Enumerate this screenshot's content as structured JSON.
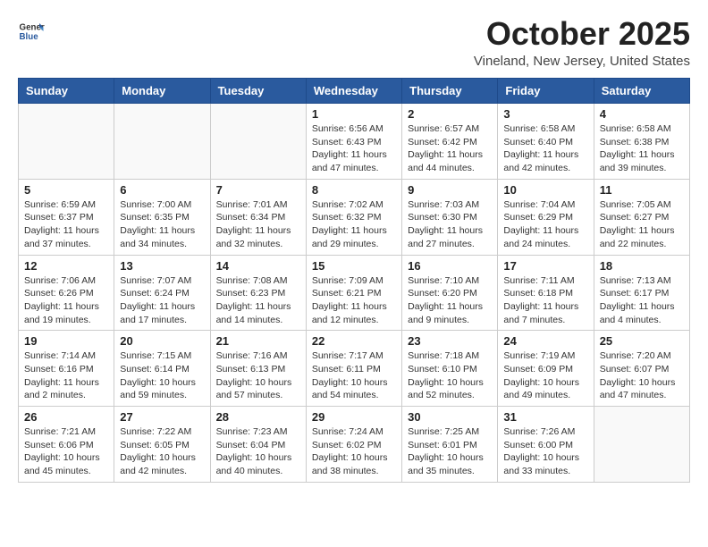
{
  "header": {
    "logo": {
      "line1": "General",
      "line2": "Blue"
    },
    "title": "October 2025",
    "location": "Vineland, New Jersey, United States"
  },
  "weekdays": [
    "Sunday",
    "Monday",
    "Tuesday",
    "Wednesday",
    "Thursday",
    "Friday",
    "Saturday"
  ],
  "weeks": [
    [
      {
        "day": "",
        "info": ""
      },
      {
        "day": "",
        "info": ""
      },
      {
        "day": "",
        "info": ""
      },
      {
        "day": "1",
        "info": "Sunrise: 6:56 AM\nSunset: 6:43 PM\nDaylight: 11 hours\nand 47 minutes."
      },
      {
        "day": "2",
        "info": "Sunrise: 6:57 AM\nSunset: 6:42 PM\nDaylight: 11 hours\nand 44 minutes."
      },
      {
        "day": "3",
        "info": "Sunrise: 6:58 AM\nSunset: 6:40 PM\nDaylight: 11 hours\nand 42 minutes."
      },
      {
        "day": "4",
        "info": "Sunrise: 6:58 AM\nSunset: 6:38 PM\nDaylight: 11 hours\nand 39 minutes."
      }
    ],
    [
      {
        "day": "5",
        "info": "Sunrise: 6:59 AM\nSunset: 6:37 PM\nDaylight: 11 hours\nand 37 minutes."
      },
      {
        "day": "6",
        "info": "Sunrise: 7:00 AM\nSunset: 6:35 PM\nDaylight: 11 hours\nand 34 minutes."
      },
      {
        "day": "7",
        "info": "Sunrise: 7:01 AM\nSunset: 6:34 PM\nDaylight: 11 hours\nand 32 minutes."
      },
      {
        "day": "8",
        "info": "Sunrise: 7:02 AM\nSunset: 6:32 PM\nDaylight: 11 hours\nand 29 minutes."
      },
      {
        "day": "9",
        "info": "Sunrise: 7:03 AM\nSunset: 6:30 PM\nDaylight: 11 hours\nand 27 minutes."
      },
      {
        "day": "10",
        "info": "Sunrise: 7:04 AM\nSunset: 6:29 PM\nDaylight: 11 hours\nand 24 minutes."
      },
      {
        "day": "11",
        "info": "Sunrise: 7:05 AM\nSunset: 6:27 PM\nDaylight: 11 hours\nand 22 minutes."
      }
    ],
    [
      {
        "day": "12",
        "info": "Sunrise: 7:06 AM\nSunset: 6:26 PM\nDaylight: 11 hours\nand 19 minutes."
      },
      {
        "day": "13",
        "info": "Sunrise: 7:07 AM\nSunset: 6:24 PM\nDaylight: 11 hours\nand 17 minutes."
      },
      {
        "day": "14",
        "info": "Sunrise: 7:08 AM\nSunset: 6:23 PM\nDaylight: 11 hours\nand 14 minutes."
      },
      {
        "day": "15",
        "info": "Sunrise: 7:09 AM\nSunset: 6:21 PM\nDaylight: 11 hours\nand 12 minutes."
      },
      {
        "day": "16",
        "info": "Sunrise: 7:10 AM\nSunset: 6:20 PM\nDaylight: 11 hours\nand 9 minutes."
      },
      {
        "day": "17",
        "info": "Sunrise: 7:11 AM\nSunset: 6:18 PM\nDaylight: 11 hours\nand 7 minutes."
      },
      {
        "day": "18",
        "info": "Sunrise: 7:13 AM\nSunset: 6:17 PM\nDaylight: 11 hours\nand 4 minutes."
      }
    ],
    [
      {
        "day": "19",
        "info": "Sunrise: 7:14 AM\nSunset: 6:16 PM\nDaylight: 11 hours\nand 2 minutes."
      },
      {
        "day": "20",
        "info": "Sunrise: 7:15 AM\nSunset: 6:14 PM\nDaylight: 10 hours\nand 59 minutes."
      },
      {
        "day": "21",
        "info": "Sunrise: 7:16 AM\nSunset: 6:13 PM\nDaylight: 10 hours\nand 57 minutes."
      },
      {
        "day": "22",
        "info": "Sunrise: 7:17 AM\nSunset: 6:11 PM\nDaylight: 10 hours\nand 54 minutes."
      },
      {
        "day": "23",
        "info": "Sunrise: 7:18 AM\nSunset: 6:10 PM\nDaylight: 10 hours\nand 52 minutes."
      },
      {
        "day": "24",
        "info": "Sunrise: 7:19 AM\nSunset: 6:09 PM\nDaylight: 10 hours\nand 49 minutes."
      },
      {
        "day": "25",
        "info": "Sunrise: 7:20 AM\nSunset: 6:07 PM\nDaylight: 10 hours\nand 47 minutes."
      }
    ],
    [
      {
        "day": "26",
        "info": "Sunrise: 7:21 AM\nSunset: 6:06 PM\nDaylight: 10 hours\nand 45 minutes."
      },
      {
        "day": "27",
        "info": "Sunrise: 7:22 AM\nSunset: 6:05 PM\nDaylight: 10 hours\nand 42 minutes."
      },
      {
        "day": "28",
        "info": "Sunrise: 7:23 AM\nSunset: 6:04 PM\nDaylight: 10 hours\nand 40 minutes."
      },
      {
        "day": "29",
        "info": "Sunrise: 7:24 AM\nSunset: 6:02 PM\nDaylight: 10 hours\nand 38 minutes."
      },
      {
        "day": "30",
        "info": "Sunrise: 7:25 AM\nSunset: 6:01 PM\nDaylight: 10 hours\nand 35 minutes."
      },
      {
        "day": "31",
        "info": "Sunrise: 7:26 AM\nSunset: 6:00 PM\nDaylight: 10 hours\nand 33 minutes."
      },
      {
        "day": "",
        "info": ""
      }
    ]
  ]
}
